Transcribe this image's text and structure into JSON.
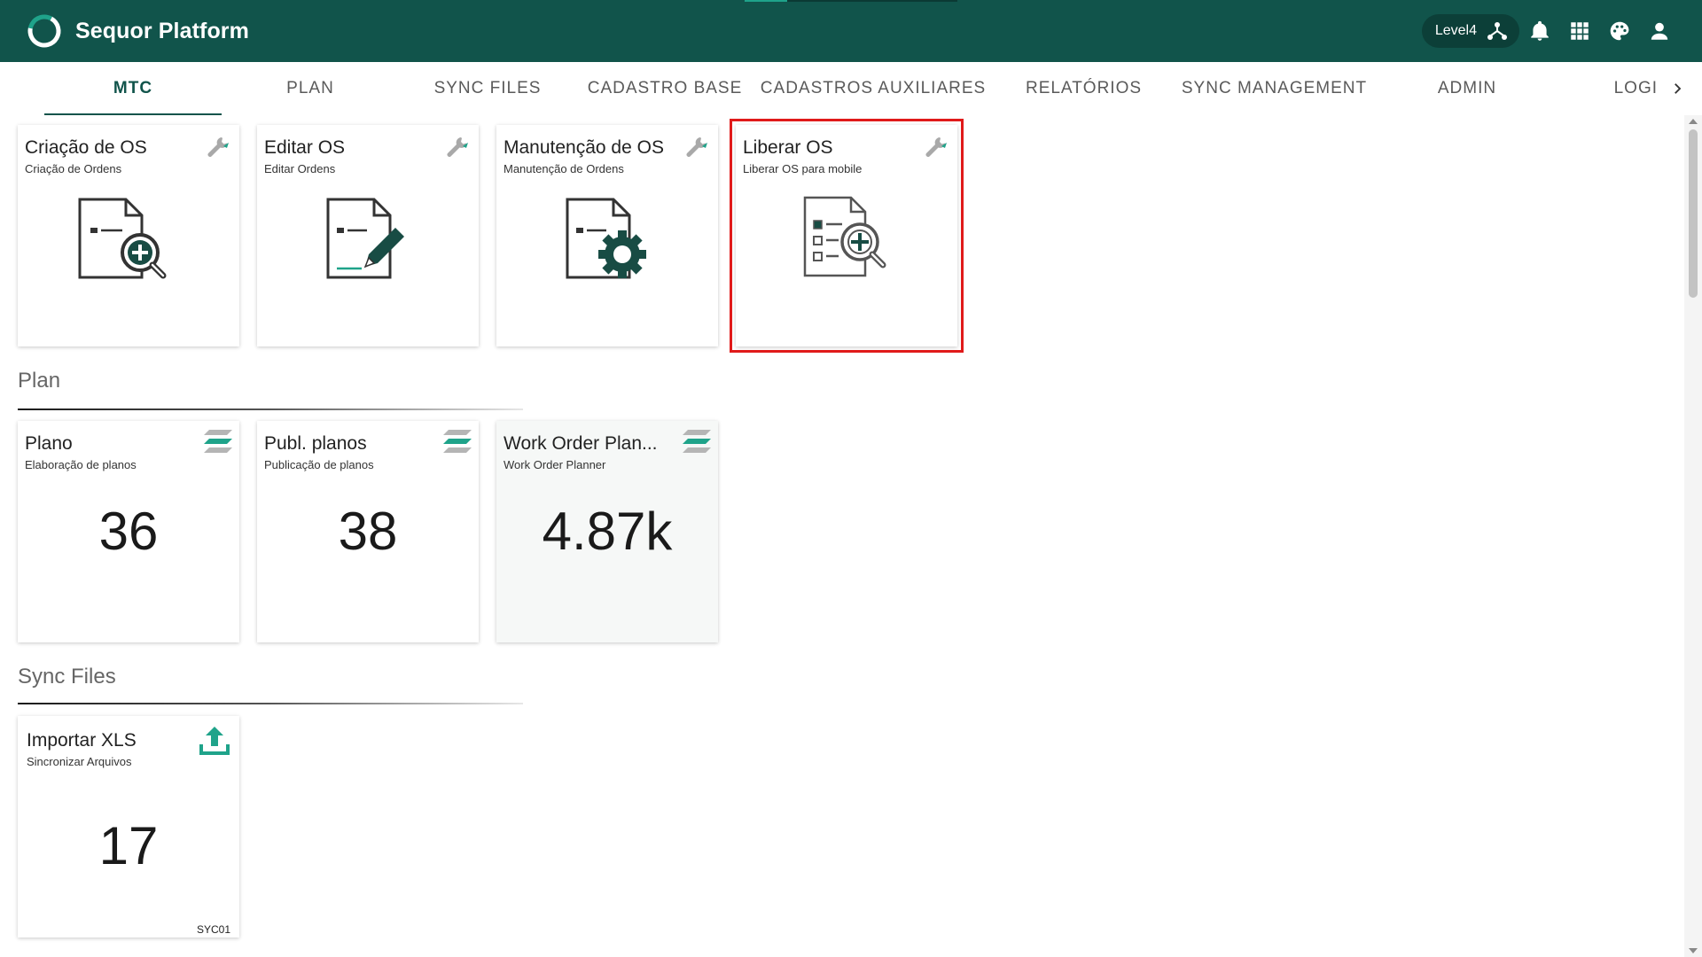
{
  "app": {
    "title": "Sequor Platform",
    "level": "Level4"
  },
  "colors": {
    "topbar": "#11544b",
    "accent": "#1fa38a",
    "highlight": "#e01a1a"
  },
  "icons": {
    "brand": "sequor-ring-logo",
    "level": "hierarchy-icon",
    "notifications": "bell-icon",
    "apps": "grid-icon",
    "theme": "palette-icon",
    "user": "person-icon",
    "tools": "wrench-icon",
    "plan": "stack-layers-icon",
    "upload": "upload-icon",
    "nav_next": "chevron-right-icon"
  },
  "tabs": [
    {
      "label": "MTC",
      "active": true
    },
    {
      "label": "PLAN"
    },
    {
      "label": "SYNC FILES"
    },
    {
      "label": "CADASTRO BASE"
    },
    {
      "label": "CADASTROS AUXILIARES"
    },
    {
      "label": "RELATÓRIOS"
    },
    {
      "label": "SYNC MANAGEMENT"
    },
    {
      "label": "ADMIN"
    },
    {
      "label": "LOGI"
    }
  ],
  "mtc": {
    "cards": [
      {
        "title": "Criação de OS",
        "subtitle": "Criação de Ordens",
        "icon": "document-search-add-icon"
      },
      {
        "title": "Editar OS",
        "subtitle": "Editar Ordens",
        "icon": "document-edit-icon"
      },
      {
        "title": "Manutenção de OS",
        "subtitle": "Manutenção de Ordens",
        "icon": "document-gear-icon"
      },
      {
        "title": "Liberar OS",
        "subtitle": "Liberar OS para mobile",
        "icon": "checklist-search-icon",
        "selected": true
      }
    ]
  },
  "plan": {
    "title": "Plan",
    "cards": [
      {
        "title": "Plano",
        "subtitle": "Elaboração de planos",
        "value": "36"
      },
      {
        "title": "Publ. planos",
        "subtitle": "Publicação de planos",
        "value": "38"
      },
      {
        "title": "Work Order Plan...",
        "subtitle": "Work Order Planner",
        "value": "4.87k"
      }
    ]
  },
  "sync": {
    "title": "Sync Files",
    "cards": [
      {
        "title": "Importar XLS",
        "subtitle": "Sincronizar Arquivos",
        "value": "17",
        "code": "SYC01"
      }
    ]
  }
}
